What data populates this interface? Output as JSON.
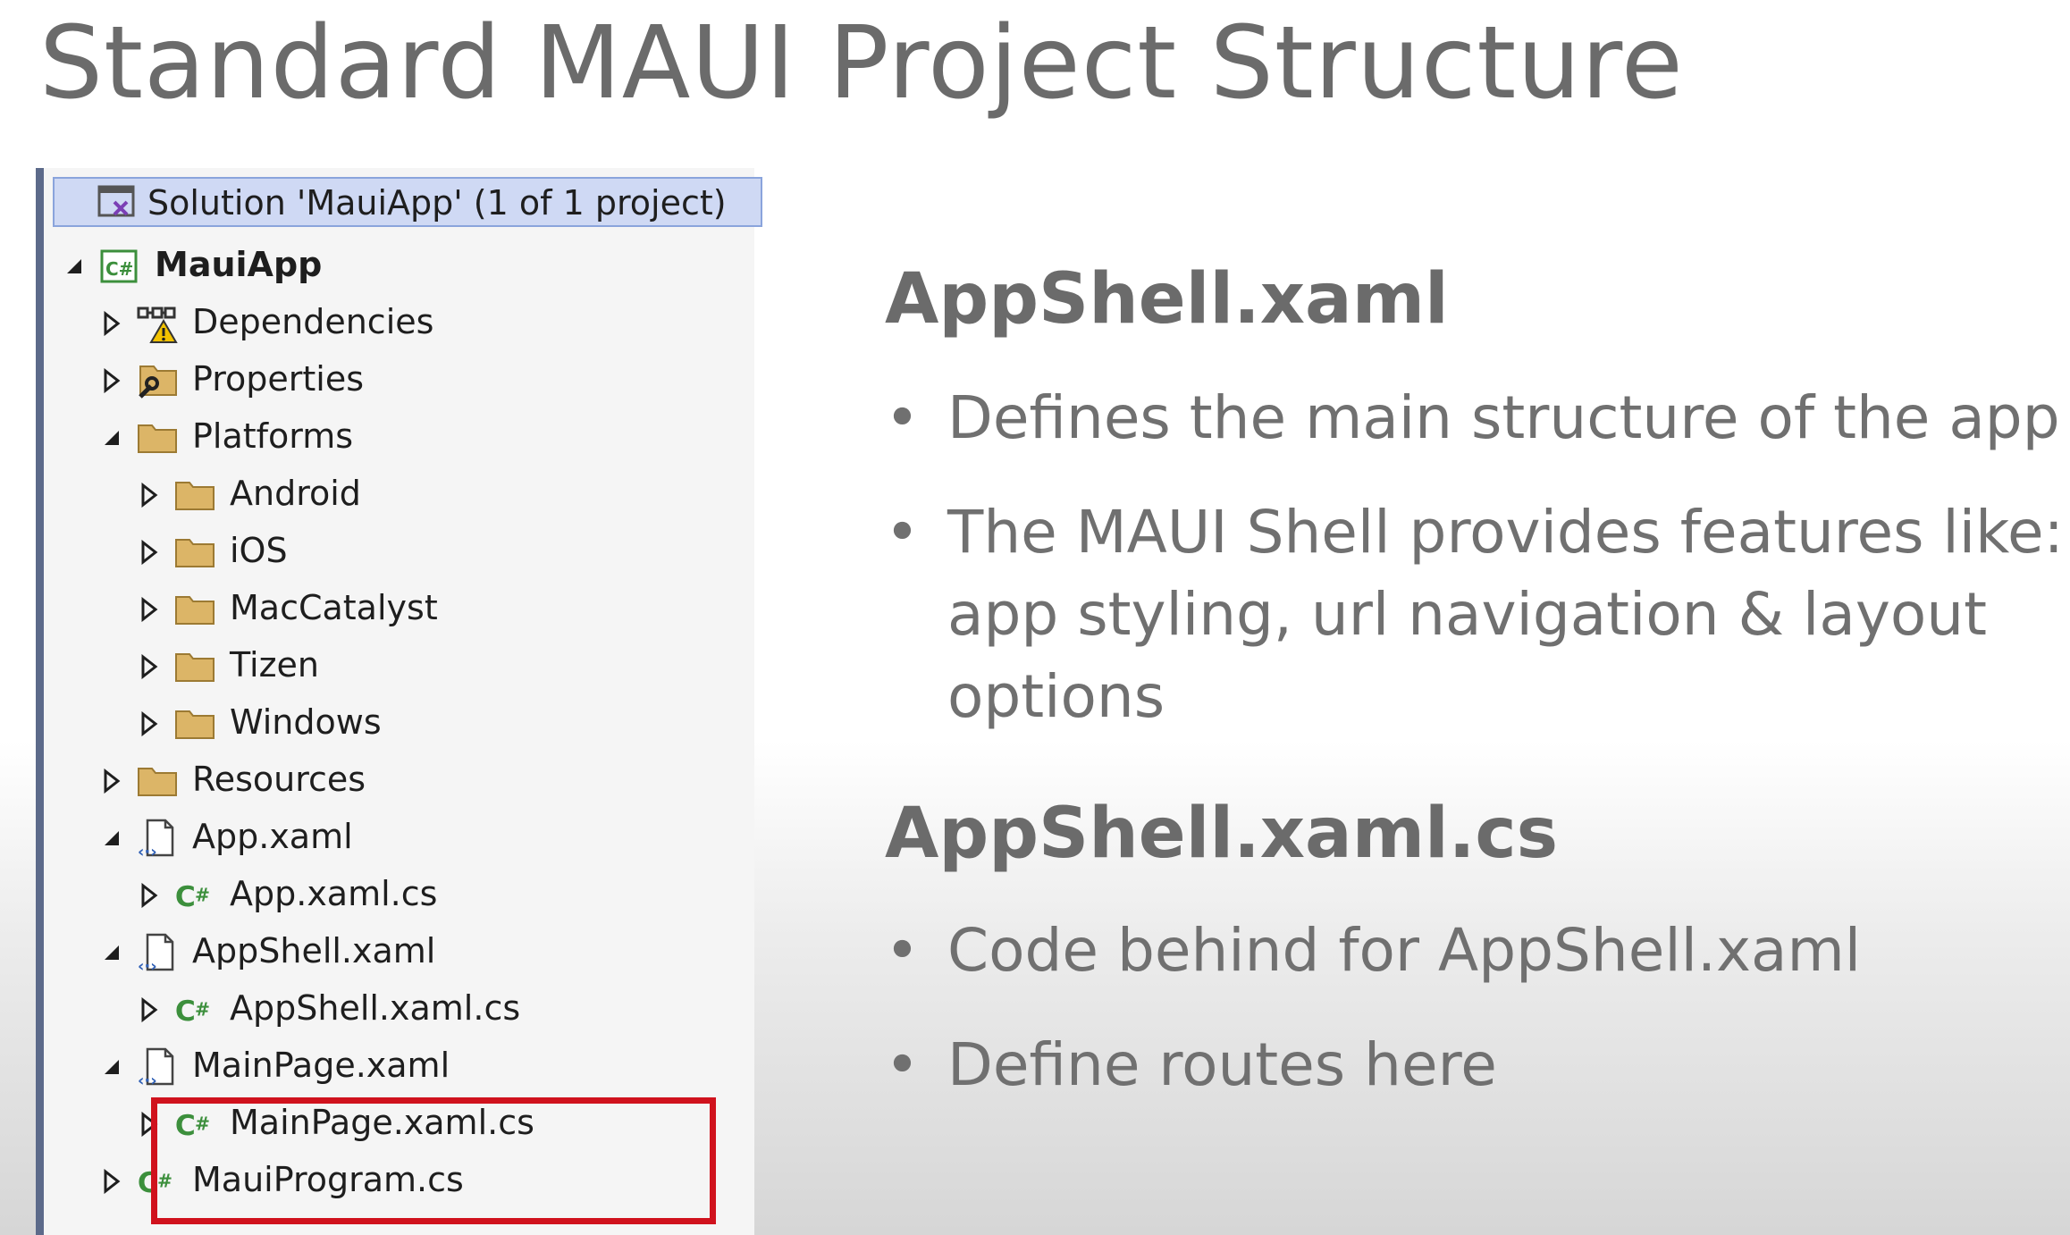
{
  "slide": {
    "title": "Standard MAUI Project Structure"
  },
  "solution_explorer": {
    "solution_label": "Solution 'MauiApp' (1 of 1 project)",
    "items": [
      {
        "label": "MauiApp",
        "icon": "csharp-project-icon",
        "expander": "expanded",
        "level": 0
      },
      {
        "label": "Dependencies",
        "icon": "dependencies-warning-icon",
        "expander": "collapsed",
        "level": 1
      },
      {
        "label": "Properties",
        "icon": "properties-folder-icon",
        "expander": "collapsed",
        "level": 1
      },
      {
        "label": "Platforms",
        "icon": "folder-icon",
        "expander": "expanded",
        "level": 1
      },
      {
        "label": "Android",
        "icon": "folder-icon",
        "expander": "collapsed",
        "level": 2
      },
      {
        "label": "iOS",
        "icon": "folder-icon",
        "expander": "collapsed",
        "level": 2
      },
      {
        "label": "MacCatalyst",
        "icon": "folder-icon",
        "expander": "collapsed",
        "level": 2
      },
      {
        "label": "Tizen",
        "icon": "folder-icon",
        "expander": "collapsed",
        "level": 2
      },
      {
        "label": "Windows",
        "icon": "folder-icon",
        "expander": "collapsed",
        "level": 2
      },
      {
        "label": "Resources",
        "icon": "folder-icon",
        "expander": "collapsed",
        "level": 1
      },
      {
        "label": "App.xaml",
        "icon": "xaml-file-icon",
        "expander": "expanded",
        "level": 1
      },
      {
        "label": "App.xaml.cs",
        "icon": "csharp-file-icon",
        "expander": "collapsed",
        "level": 2
      },
      {
        "label": "AppShell.xaml",
        "icon": "xaml-file-icon",
        "expander": "expanded",
        "level": 1
      },
      {
        "label": "AppShell.xaml.cs",
        "icon": "csharp-file-icon",
        "expander": "collapsed",
        "level": 2
      },
      {
        "label": "MainPage.xaml",
        "icon": "xaml-file-icon",
        "expander": "expanded",
        "level": 1
      },
      {
        "label": "MainPage.xaml.cs",
        "icon": "csharp-file-icon",
        "expander": "collapsed",
        "level": 2
      },
      {
        "label": "MauiProgram.cs",
        "icon": "csharp-file-icon",
        "expander": "collapsed",
        "level": 1
      }
    ]
  },
  "sections": [
    {
      "heading": "AppShell.xaml",
      "bullets": [
        [
          "Defines the main structure of the app"
        ],
        [
          "The MAUI Shell provides features like:",
          "app styling, url navigation & layout",
          "options"
        ]
      ]
    },
    {
      "heading": "AppShell.xaml.cs",
      "bullets": [
        [
          "Code behind for AppShell.xaml"
        ],
        [
          "Define routes here"
        ]
      ]
    }
  ],
  "colors": {
    "highlight_box": "#d0121d",
    "solution_row": "#cfd9f4",
    "folder": "#dcb567",
    "csharp_green": "#3c8f3c"
  }
}
